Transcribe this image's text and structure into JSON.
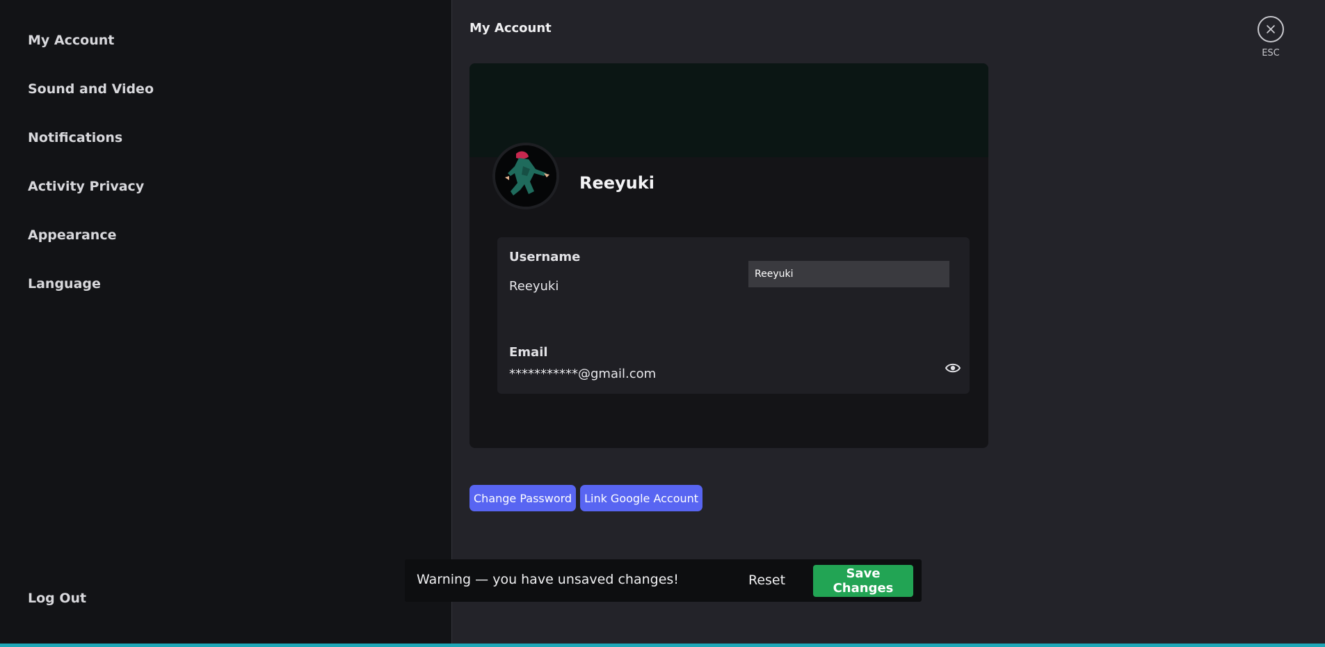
{
  "sidebar": {
    "items": [
      {
        "label": "My Account"
      },
      {
        "label": "Sound and Video"
      },
      {
        "label": "Notifications"
      },
      {
        "label": "Activity Privacy"
      },
      {
        "label": "Appearance"
      },
      {
        "label": "Language"
      }
    ],
    "logout_label": "Log Out"
  },
  "header": {
    "title": "My Account",
    "close_label": "ESC"
  },
  "profile": {
    "display_name": "Reeyuki",
    "username_label": "Username",
    "username_value": "Reeyuki",
    "username_input_value": "Reeyuki",
    "email_label": "Email",
    "email_value": "***********@gmail.com"
  },
  "actions": {
    "change_password_label": "Change Password",
    "link_google_label": "Link Google Account"
  },
  "unsaved_bar": {
    "warning_text": "Warning — you have unsaved changes!",
    "reset_label": "Reset",
    "save_label": "Save Changes"
  },
  "colors": {
    "accent_purple": "#5865f2",
    "save_green": "#22a454",
    "bottom_line": "#1fa8b8"
  }
}
